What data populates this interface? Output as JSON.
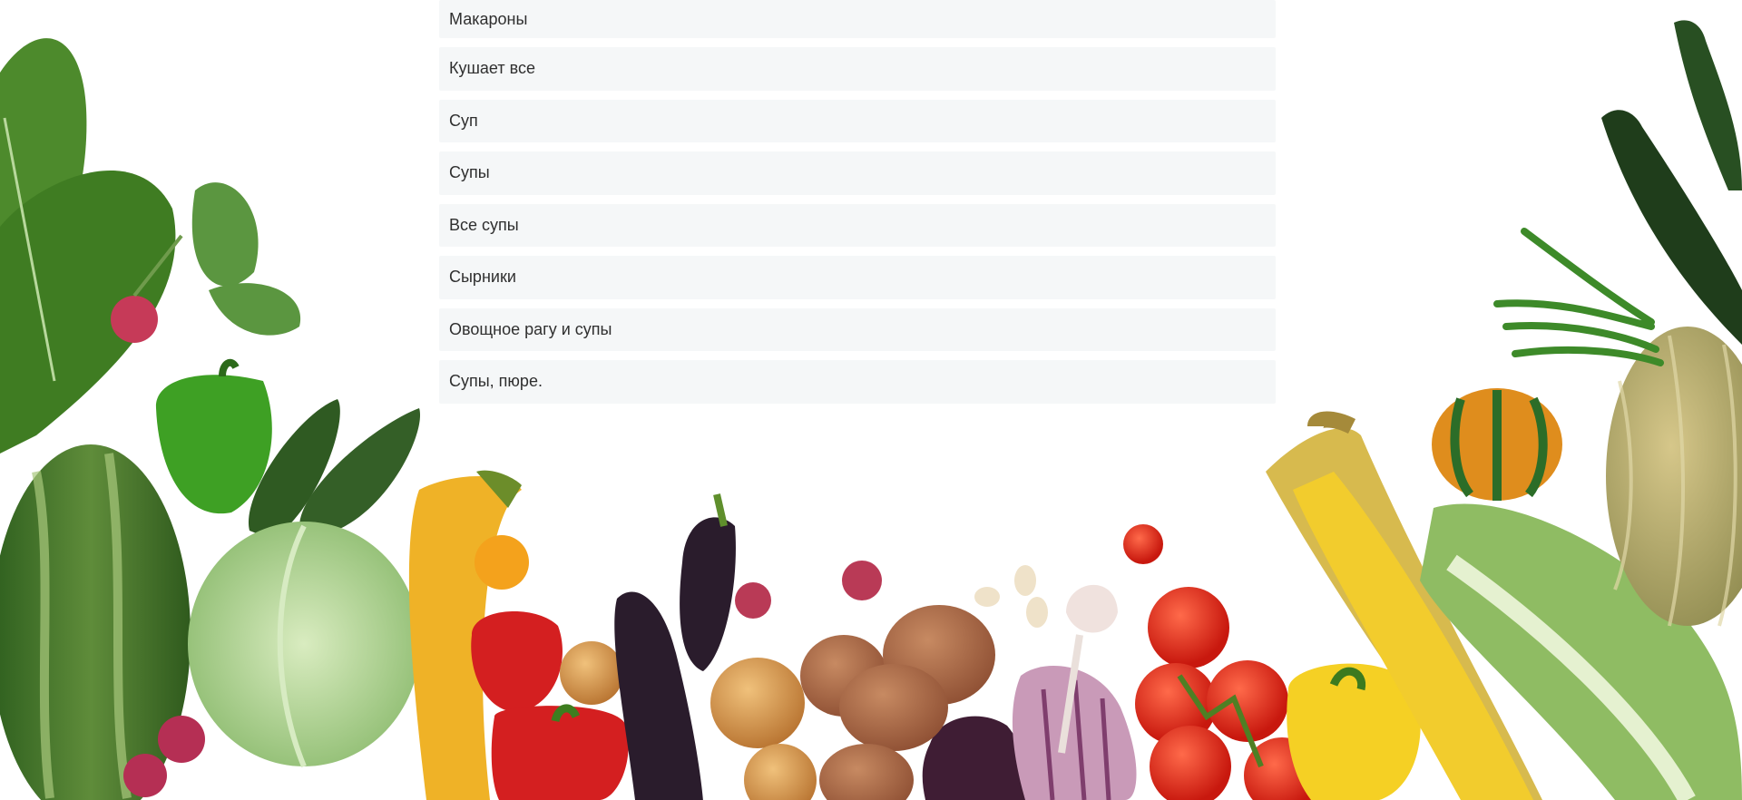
{
  "recipe_list": {
    "items": [
      {
        "label": "Макароны"
      },
      {
        "label": "Кушает все"
      },
      {
        "label": "Суп"
      },
      {
        "label": "Супы"
      },
      {
        "label": "Все супы"
      },
      {
        "label": "Сырники"
      },
      {
        "label": "Овощное рагу и супы"
      },
      {
        "label": "Супы, пюре."
      }
    ]
  },
  "colors": {
    "item_background": "#f5f7f8",
    "text": "#2f2f2f"
  }
}
